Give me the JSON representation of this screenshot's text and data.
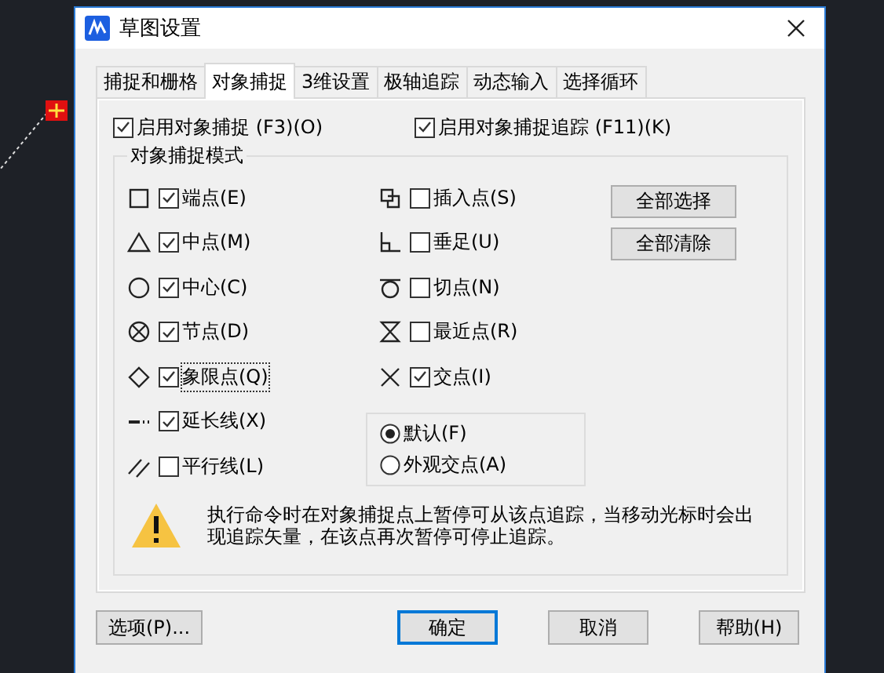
{
  "window": {
    "title": "草图设置"
  },
  "tabs": [
    {
      "label": "捕捉和栅格",
      "selected": false
    },
    {
      "label": "对象捕捉",
      "selected": true
    },
    {
      "label": "3维设置",
      "selected": false
    },
    {
      "label": "极轴追踪",
      "selected": false
    },
    {
      "label": "动态输入",
      "selected": false
    },
    {
      "label": "选择循环",
      "selected": false
    }
  ],
  "enable_snap": {
    "label": "启用对象捕捉 (F3)(O)",
    "checked": true
  },
  "enable_tracking": {
    "label": "启用对象捕捉追踪 (F11)(K)",
    "checked": true
  },
  "group": {
    "title": "对象捕捉模式"
  },
  "snap_modes_left": [
    {
      "label": "端点(E)",
      "checked": true,
      "focused": false
    },
    {
      "label": "中点(M)",
      "checked": true,
      "focused": false
    },
    {
      "label": "中心(C)",
      "checked": true,
      "focused": false
    },
    {
      "label": "节点(D)",
      "checked": true,
      "focused": false
    },
    {
      "label": "象限点(Q)",
      "checked": true,
      "focused": true
    },
    {
      "label": "延长线(X)",
      "checked": true,
      "focused": false
    },
    {
      "label": "平行线(L)",
      "checked": false,
      "focused": false
    }
  ],
  "snap_modes_right": [
    {
      "label": "插入点(S)",
      "checked": false,
      "focused": false
    },
    {
      "label": "垂足(U)",
      "checked": false,
      "focused": false
    },
    {
      "label": "切点(N)",
      "checked": false,
      "focused": false
    },
    {
      "label": "最近点(R)",
      "checked": false,
      "focused": false
    },
    {
      "label": "交点(I)",
      "checked": true,
      "focused": false
    }
  ],
  "side_buttons": [
    "全部选择",
    "全部清除"
  ],
  "intersection_options": [
    {
      "label": "默认(F)",
      "selected": true
    },
    {
      "label": "外观交点(A)",
      "selected": false
    }
  ],
  "hint": "执行命令时在对象捕捉点上暂停可从该点追踪，当移动光标时会出现追踪矢量，在该点再次暂停可停止追踪。",
  "footer_buttons": [
    {
      "label": "选项(P)...",
      "default": false
    },
    {
      "label": "确定",
      "default": true
    },
    {
      "label": "取消",
      "default": false
    },
    {
      "label": "帮助(H)",
      "default": false
    }
  ]
}
